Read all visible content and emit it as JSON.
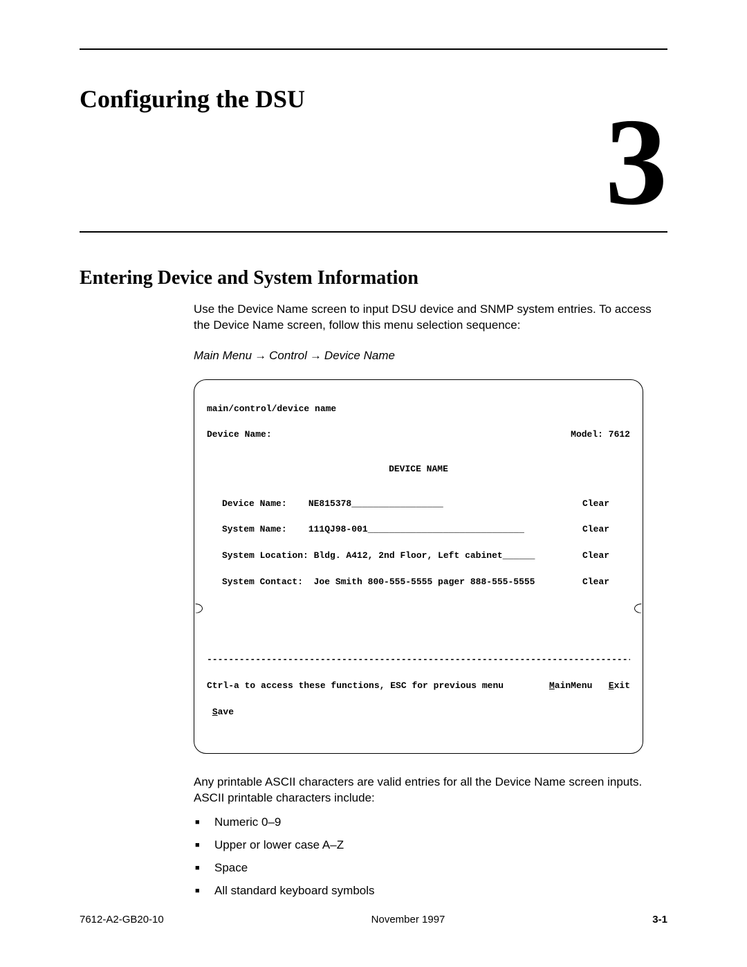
{
  "chapter": {
    "title": "Configuring the DSU",
    "number": "3"
  },
  "section": {
    "title": "Entering Device and System Information",
    "intro": "Use the Device Name screen to input DSU device and SNMP system entries. To access the Device Name screen, follow this menu selection sequence:",
    "nav": {
      "a": "Main Menu",
      "b": "Control",
      "c": "Device Name"
    }
  },
  "terminal": {
    "path": "main/control/device name",
    "screen_label": "Device Name:",
    "model_label": "Model:",
    "model_value": "7612",
    "heading": "DEVICE NAME",
    "fields": [
      {
        "label": "Device Name:    ",
        "value": "NE815378_________________",
        "action": "Clear"
      },
      {
        "label": "System Name:    ",
        "value": "111QJ98-001_____________________________",
        "action": "Clear"
      },
      {
        "label": "System Location:",
        "value": " Bldg. A412, 2nd Floor, Left cabinet______",
        "action": "Clear"
      },
      {
        "label": "System Contact: ",
        "value": " Joe Smith 800-555-5555 pager 888-555-5555",
        "action": "Clear"
      }
    ],
    "separator": "-------------------------------------------------------------------------------",
    "help": "Ctrl-a to access these functions, ESC for previous menu",
    "menu_main_u": "M",
    "menu_main_rest": "ainMenu",
    "menu_exit_u": "E",
    "menu_exit_rest": "xit",
    "save_u": "S",
    "save_rest": "ave"
  },
  "post": {
    "text": "Any printable ASCII characters are valid entries for all the Device Name screen inputs. ASCII printable characters include:",
    "items": [
      "Numeric 0–9",
      "Upper or lower case A–Z",
      "Space",
      "All standard keyboard symbols"
    ]
  },
  "footer": {
    "docnum": "7612-A2-GB20-10",
    "date": "November 1997",
    "page": "3-1"
  }
}
